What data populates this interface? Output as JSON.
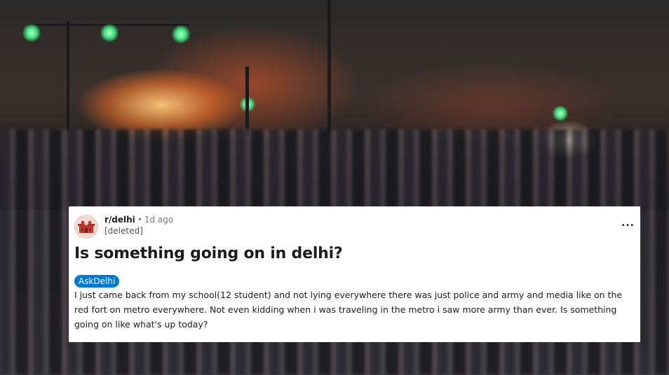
{
  "post": {
    "subreddit": "r/delhi",
    "separator": "•",
    "time": "1d ago",
    "author": "[deleted]",
    "more_label": "...",
    "title": "Is something going on in delhi?",
    "flair": "AskDelhi",
    "body": "I just came back from my school(12 student) and not lying everywhere there was just police and army and media like on the red fort on metro everywhere. Not even kidding when i was traveling in the metro i saw more army than ever. Is something going on like what's up today?"
  },
  "colors": {
    "flair_bg": "#0079d3",
    "card_bg": "#ffffff",
    "text": "#1c1c1c",
    "muted": "#7c7c7c"
  },
  "icons": {
    "avatar": "red-fort-avatar-icon",
    "more": "more-options-icon"
  }
}
